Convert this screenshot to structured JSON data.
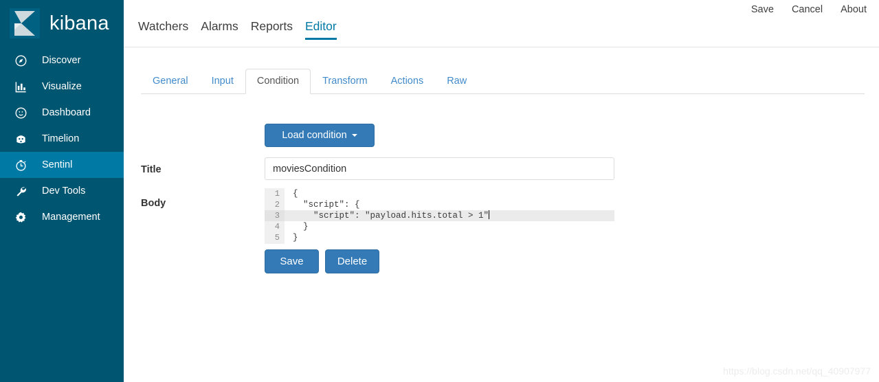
{
  "brand": {
    "name": "kibana",
    "logo_icon": "kibana-logo-icon"
  },
  "sidebar": {
    "background_color": "#005571",
    "active_color": "#0079a5",
    "items": [
      {
        "label": "Discover",
        "icon": "compass-icon",
        "active": false
      },
      {
        "label": "Visualize",
        "icon": "bar-chart-icon",
        "active": false
      },
      {
        "label": "Dashboard",
        "icon": "dashboard-icon",
        "active": false
      },
      {
        "label": "Timelion",
        "icon": "timelion-icon",
        "active": false
      },
      {
        "label": "Sentinl",
        "icon": "stopwatch-icon",
        "active": true
      },
      {
        "label": "Dev Tools",
        "icon": "wrench-icon",
        "active": false
      },
      {
        "label": "Management",
        "icon": "gear-icon",
        "active": false
      }
    ]
  },
  "topbar": {
    "links": [
      {
        "label": "Save"
      },
      {
        "label": "Cancel"
      },
      {
        "label": "About"
      }
    ]
  },
  "main_nav": {
    "accent_color": "#0079a5",
    "items": [
      {
        "label": "Watchers",
        "active": false
      },
      {
        "label": "Alarms",
        "active": false
      },
      {
        "label": "Reports",
        "active": false
      },
      {
        "label": "Editor",
        "active": true
      }
    ]
  },
  "sub_tabs": {
    "link_color": "#428bca",
    "items": [
      {
        "label": "General",
        "active": false
      },
      {
        "label": "Input",
        "active": false
      },
      {
        "label": "Condition",
        "active": true
      },
      {
        "label": "Transform",
        "active": false
      },
      {
        "label": "Actions",
        "active": false
      },
      {
        "label": "Raw",
        "active": false
      }
    ]
  },
  "form": {
    "load_button": {
      "label": "Load condition",
      "caret_icon": "caret-down-icon",
      "color": "#337ab7"
    },
    "title": {
      "label": "Title",
      "value": "moviesCondition",
      "placeholder": ""
    },
    "body": {
      "label": "Body",
      "active_line": 3,
      "lines": [
        {
          "num": "1",
          "text": "{"
        },
        {
          "num": "2",
          "text": "  \"script\": {"
        },
        {
          "num": "3",
          "text": "    \"script\": \"payload.hits.total > 1\""
        },
        {
          "num": "4",
          "text": "  }"
        },
        {
          "num": "5",
          "text": "}"
        }
      ]
    },
    "actions": [
      {
        "label": "Save",
        "name": "save-button"
      },
      {
        "label": "Delete",
        "name": "delete-button"
      }
    ]
  },
  "watermark": {
    "text": "https://blog.csdn.net/qq_40907977"
  }
}
